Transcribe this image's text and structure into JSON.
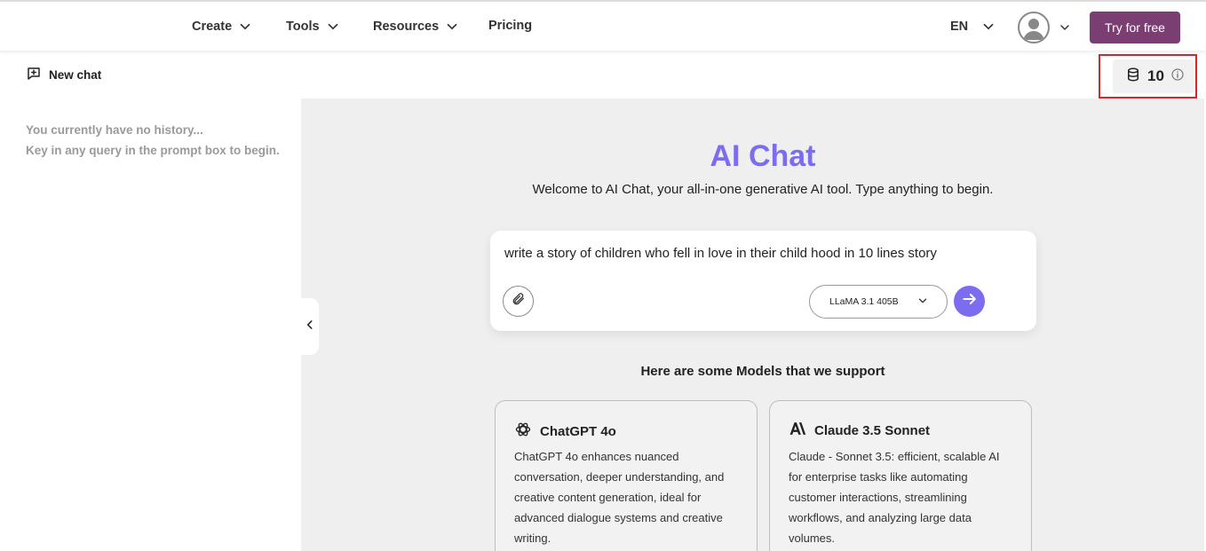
{
  "nav": {
    "items": [
      {
        "label": "Create",
        "has_dropdown": true
      },
      {
        "label": "Tools",
        "has_dropdown": true
      },
      {
        "label": "Resources",
        "has_dropdown": true
      },
      {
        "label": "Pricing",
        "has_dropdown": false
      }
    ],
    "language": "EN",
    "cta_label": "Try for free"
  },
  "sidebar": {
    "new_chat_label": "New chat",
    "history_line1": "You currently have no history...",
    "history_line2": "Key in any query in the prompt box to begin."
  },
  "credits": {
    "value": "10"
  },
  "main": {
    "title": "AI Chat",
    "subtitle": "Welcome to AI Chat, your all-in-one generative AI tool. Type anything to begin.",
    "prompt_value": "write a story of children who fell in love in their child hood in 10 lines story",
    "model_selected": "LLaMA 3.1 405B",
    "models_heading": "Here are some Models that we support"
  },
  "models": [
    {
      "name": "ChatGPT 4o",
      "icon": "openai-icon",
      "description": "ChatGPT 4o enhances nuanced conversation, deeper understanding, and creative content generation, ideal for advanced dialogue systems and creative writing."
    },
    {
      "name": "Claude 3.5 Sonnet",
      "icon": "anthropic-icon",
      "description": "Claude - Sonnet 3.5: efficient, scalable AI for enterprise tasks like automating customer interactions, streamlining workflows, and analyzing large data volumes."
    }
  ],
  "colors": {
    "accent_purple": "#7b6cf0",
    "cta_plum": "#7b3e73",
    "highlight_red": "#e0222a",
    "main_bg": "#efefef"
  }
}
